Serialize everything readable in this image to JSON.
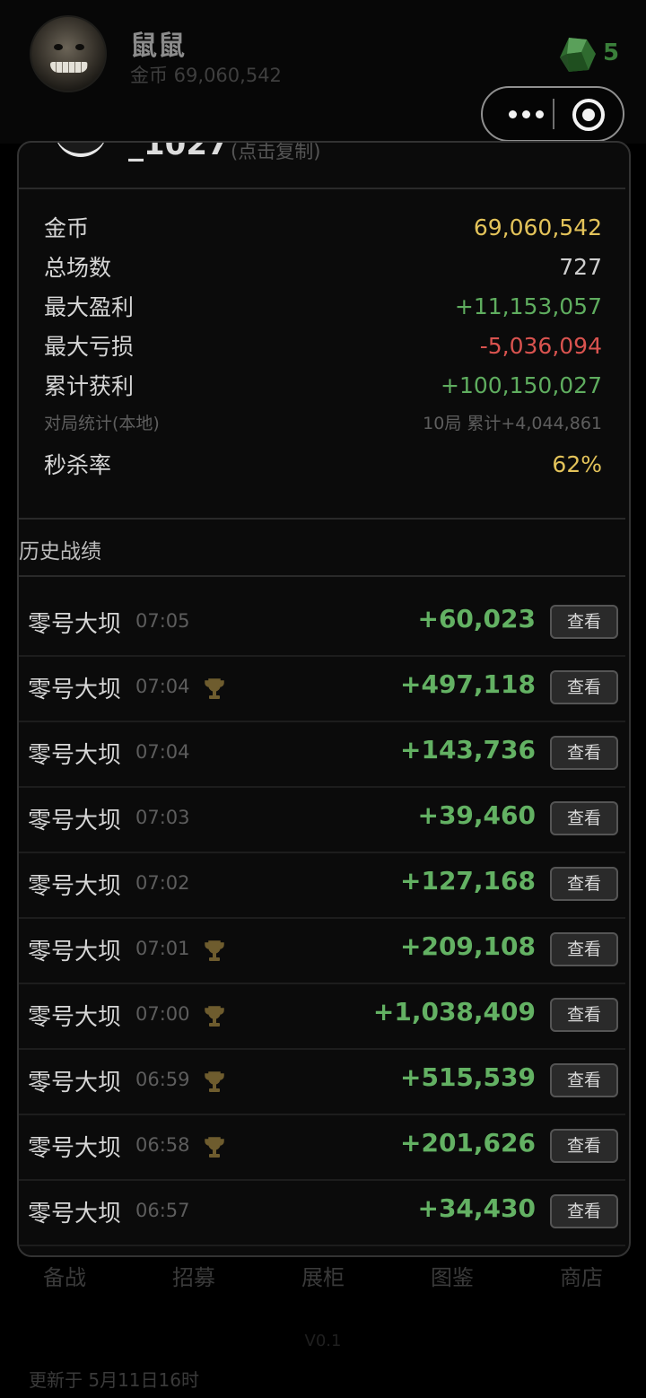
{
  "header": {
    "nickname": "鼠鼠",
    "coins_text": "金币 69,060,542",
    "gem_count": "5"
  },
  "modal": {
    "id_text": "_1027",
    "copy_hint": "(点击复制)",
    "stats": [
      {
        "label": "金币",
        "value": "69,060,542",
        "color": "#e3c35a"
      },
      {
        "label": "总场数",
        "value": "727",
        "color": "#cfcfcf"
      },
      {
        "label": "最大盈利",
        "value": "+11,153,057",
        "color": "#5fad5f"
      },
      {
        "label": "最大亏损",
        "value": "-5,036,094",
        "color": "#d9534f"
      },
      {
        "label": "累计获利",
        "value": "+100,150,027",
        "color": "#5fad5f"
      }
    ],
    "local_stats": {
      "label": "对局统计(本地)",
      "value": "10局 累计+4,044,861"
    },
    "kill_rate": {
      "label": "秒杀率",
      "value": "62%",
      "color": "#e3c35a"
    },
    "history_title": "历史战绩",
    "view_label": "查看",
    "history": [
      {
        "map": "零号大坝",
        "time": "07:05",
        "trophy": false,
        "profit": "+60,023"
      },
      {
        "map": "零号大坝",
        "time": "07:04",
        "trophy": true,
        "profit": "+497,118"
      },
      {
        "map": "零号大坝",
        "time": "07:04",
        "trophy": false,
        "profit": "+143,736"
      },
      {
        "map": "零号大坝",
        "time": "07:03",
        "trophy": false,
        "profit": "+39,460"
      },
      {
        "map": "零号大坝",
        "time": "07:02",
        "trophy": false,
        "profit": "+127,168"
      },
      {
        "map": "零号大坝",
        "time": "07:01",
        "trophy": true,
        "profit": "+209,108"
      },
      {
        "map": "零号大坝",
        "time": "07:00",
        "trophy": true,
        "profit": "+1,038,409"
      },
      {
        "map": "零号大坝",
        "time": "06:59",
        "trophy": true,
        "profit": "+515,539"
      },
      {
        "map": "零号大坝",
        "time": "06:58",
        "trophy": true,
        "profit": "+201,626"
      },
      {
        "map": "零号大坝",
        "time": "06:57",
        "trophy": false,
        "profit": "+34,430"
      }
    ]
  },
  "bottom_nav": [
    "备战",
    "招募",
    "展柜",
    "图鉴",
    "商店"
  ],
  "version": "V0.1",
  "updated": "更新于 5月11日16时"
}
